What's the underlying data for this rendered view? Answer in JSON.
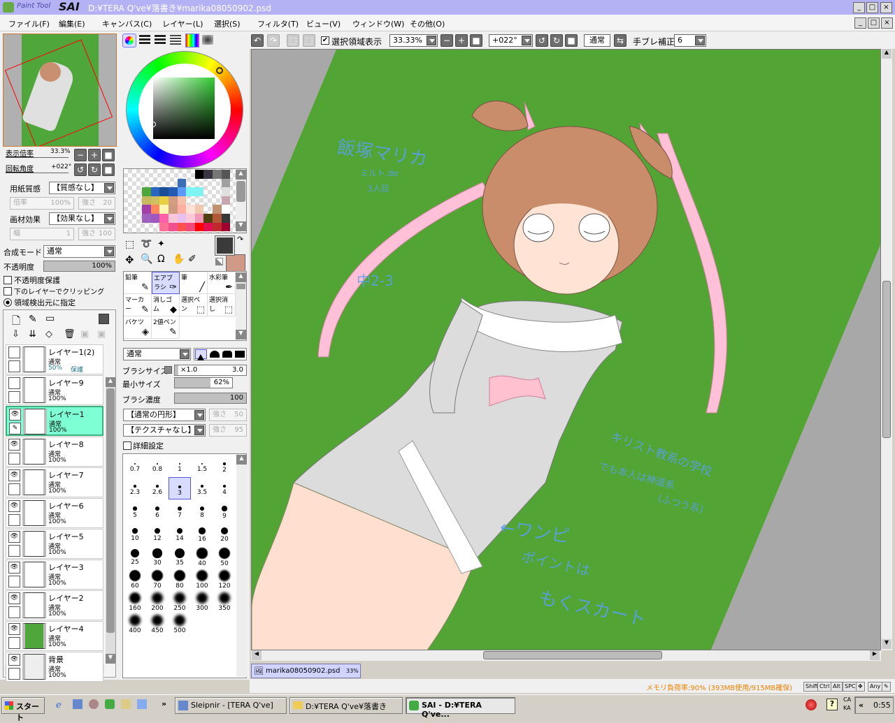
{
  "window": {
    "app_logo_small": "Paint Tool",
    "app_logo_big": "SAI",
    "title": "D:¥TERA Q've¥落書き¥marika08050902.psd",
    "min": "_",
    "max": "□",
    "close": "×"
  },
  "menu": [
    "ファイル(F)",
    "編集(E)",
    "キャンバス(C)",
    "レイヤー(L)",
    "選択(S)",
    "フィルタ(T)",
    "ビュー(V)",
    "ウィンドウ(W)",
    "その他(O)"
  ],
  "navigator": {
    "zoom_label": "表示倍率",
    "zoom_value": "33.3%",
    "rotate_label": "回転角度",
    "rotate_value": "+022°"
  },
  "paper": {
    "label": "用紙質感",
    "value": "【質感なし】",
    "scale_label": "倍率",
    "scale_value": "100%",
    "strength_label": "強さ",
    "strength_value": "20"
  },
  "material": {
    "label": "画材効果",
    "value": "【効果なし】",
    "width_label": "幅",
    "width_value": "1",
    "strength_label": "強さ",
    "strength_value": "100"
  },
  "blend": {
    "label": "合成モード",
    "value": "通常"
  },
  "opacity": {
    "label": "不透明度",
    "value": "100%",
    "percent": 100
  },
  "options": {
    "protect": "不透明度保護",
    "clip": "下のレイヤーでクリッピング",
    "detect": "領域検出元に指定"
  },
  "layers": [
    {
      "name": "レイヤー1(2)",
      "mode": "通常",
      "opacity": "50%",
      "extra": "保護",
      "visible": false,
      "thumb": "#fff"
    },
    {
      "name": "レイヤー9",
      "mode": "通常",
      "opacity": "100%",
      "visible": false,
      "thumb": "#fff"
    },
    {
      "name": "レイヤー1",
      "mode": "通常",
      "opacity": "100%",
      "visible": true,
      "selected": true,
      "thumb": "#fff"
    },
    {
      "name": "レイヤー8",
      "mode": "通常",
      "opacity": "100%",
      "visible": true,
      "thumb": "#fff"
    },
    {
      "name": "レイヤー7",
      "mode": "通常",
      "opacity": "100%",
      "visible": true,
      "thumb": "#fff"
    },
    {
      "name": "レイヤー6",
      "mode": "通常",
      "opacity": "100%",
      "visible": true,
      "thumb": "#fff"
    },
    {
      "name": "レイヤー5",
      "mode": "通常",
      "opacity": "100%",
      "visible": true,
      "thumb": "#fff"
    },
    {
      "name": "レイヤー3",
      "mode": "通常",
      "opacity": "100%",
      "visible": true,
      "thumb": "#fff"
    },
    {
      "name": "レイヤー2",
      "mode": "通常",
      "opacity": "100%",
      "visible": true,
      "thumb": "#fff"
    },
    {
      "name": "レイヤー4",
      "mode": "通常",
      "opacity": "100%",
      "visible": true,
      "thumb": "#4fa63a"
    },
    {
      "name": "背景",
      "mode": "通常",
      "opacity": "100%",
      "visible": true,
      "thumb": "#eee"
    }
  ],
  "palette": [
    [
      null,
      null,
      null,
      null,
      null,
      null,
      null,
      null,
      "#000000",
      "#3a3540",
      "#777777",
      "#555555"
    ],
    [
      null,
      null,
      null,
      null,
      null,
      null,
      "#3d6db5",
      null,
      null,
      null,
      null,
      "#a0a0a0"
    ],
    [
      null,
      null,
      "#4fa63a",
      "#2a66c0",
      "#1c4e98",
      "#2359b0",
      "#5b9bf5",
      "#7ef5f5",
      "#80f2f2",
      null,
      null,
      "#e0e0e0"
    ],
    [
      null,
      null,
      "#c8b860",
      "#d0c060",
      "#e8d040",
      "#d49c80",
      "#f5c0a8",
      null,
      null,
      null,
      null,
      "#c8a8b0"
    ],
    [
      null,
      null,
      "#a040a8",
      "#ff8860",
      "#fff5b0",
      "#d09a80",
      "#ffb0a0",
      "#ffe0d8",
      "#f0c8b0",
      null,
      "#c09070",
      "#ffffff"
    ],
    [
      null,
      null,
      "#a060c0",
      "#a058c0",
      "#ff60a8",
      "#f8c8d8",
      "#e8c0f0",
      "#ffc8d8",
      "#f098b8",
      "#504010",
      "#b05838",
      "#383838"
    ],
    [
      null,
      null,
      null,
      null,
      "#ff7098",
      "#f05090",
      "#ff5050",
      "#f04878",
      "#ff0000",
      "#e01050",
      "#c02830",
      "#a00030"
    ]
  ],
  "colors": {
    "foreground": "#3a3a3a",
    "background": "#d09a88"
  },
  "tools": [
    {
      "label": "鉛筆",
      "icon": "pencil-icon",
      "glyph": "✎"
    },
    {
      "label": "エアブラシ",
      "icon": "airbrush-icon",
      "glyph": "✑",
      "selected": true
    },
    {
      "label": "筆",
      "icon": "brush-icon",
      "glyph": "╱"
    },
    {
      "label": "水彩筆",
      "icon": "watercolor-icon",
      "glyph": "✒"
    },
    {
      "label": "マーカー",
      "icon": "marker-icon",
      "glyph": "✎"
    },
    {
      "label": "消しゴム",
      "icon": "eraser-icon",
      "glyph": "◆"
    },
    {
      "label": "選択ペン",
      "icon": "select-pen-icon",
      "glyph": "⬚"
    },
    {
      "label": "選択消し",
      "icon": "select-erase-icon",
      "glyph": "⬚"
    },
    {
      "label": "バケツ",
      "icon": "bucket-icon",
      "glyph": "◈"
    },
    {
      "label": "2値ペン",
      "icon": "binary-pen-icon",
      "glyph": "✎"
    }
  ],
  "brush": {
    "mode": "通常",
    "size_label": "ブラシサイズ",
    "size_mult": "×1.0",
    "size_value": "3.0",
    "min_label": "最小サイズ",
    "min_value": "62%",
    "min_percent": 62,
    "density_label": "ブラシ濃度",
    "density_value": "100",
    "density_percent": 100,
    "shape": "【通常の円形】",
    "shape_strength_label": "強さ",
    "shape_strength": "50",
    "texture": "【テクスチャなし】",
    "texture_strength_label": "強さ",
    "texture_strength": "95",
    "detail": "詳細設定"
  },
  "sizes": [
    "0.7",
    "0.8",
    "1",
    "1.5",
    "2",
    "2.3",
    "2.6",
    "3",
    "3.5",
    "4",
    "5",
    "6",
    "7",
    "8",
    "9",
    "10",
    "12",
    "14",
    "16",
    "20",
    "25",
    "30",
    "35",
    "40",
    "50",
    "60",
    "70",
    "80",
    "100",
    "120",
    "160",
    "200",
    "250",
    "300",
    "350",
    "400",
    "450",
    "500"
  ],
  "selected_size": "3",
  "toolbar": {
    "show_selection": "選択領域表示",
    "zoom": "33.33%",
    "angle": "+022°",
    "mode": "通常",
    "stabilizer_label": "手ブレ補正",
    "stabilizer": "6"
  },
  "canvas_notes": {
    "name": "飯塚マリカ",
    "sub1": "ミルト.de",
    "sub2": "3人目",
    "grade": "中2-3",
    "school1": "キリスト教系の学校",
    "school2": "でも本人は神道系",
    "school3": "(ふつう系)",
    "dress1": "←ワンピ",
    "dress2": "ポイントは",
    "dress3": "もくスカート"
  },
  "doc_tab": {
    "name": "marika08050902.psd",
    "zoom": "33%"
  },
  "status": {
    "memory": "メモリ負荷率:90% (393MB使用/915MB確保)",
    "keys": [
      "Shift",
      "Ctrl",
      "Alt",
      "SPC",
      "✥",
      "Any",
      "✎"
    ]
  },
  "taskbar": {
    "start": "スタート",
    "more": "»",
    "tasks": [
      "Sleipnir - [TERA Q've]",
      "D:¥TERA Q've¥落書き",
      "SAI - D:¥TERA Q've..."
    ],
    "ime1": "CA",
    "ime2": "KA",
    "chev": "«",
    "clock": "0:55"
  }
}
